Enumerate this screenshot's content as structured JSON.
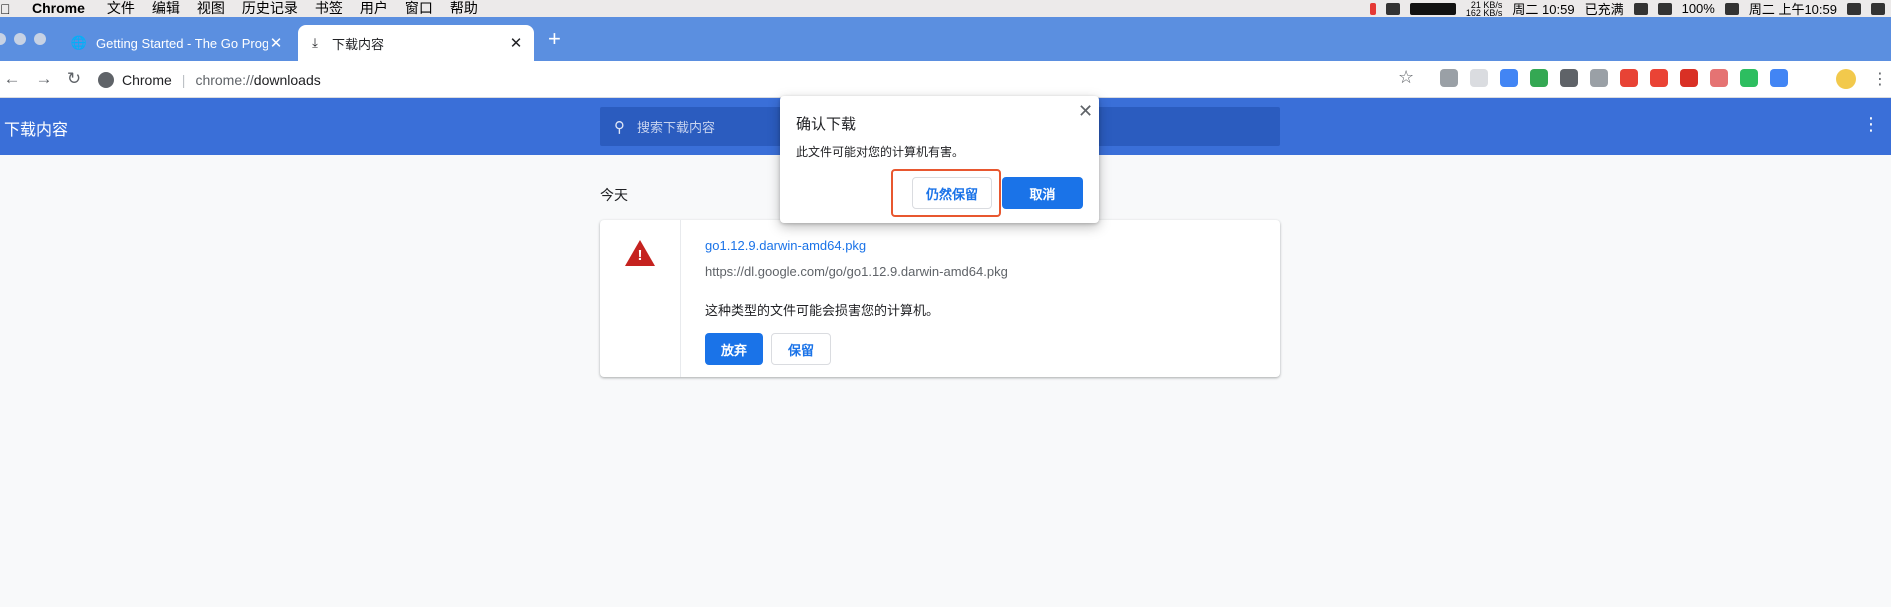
{
  "menubar": {
    "app": "Chrome",
    "items": [
      "文件",
      "编辑",
      "视图",
      "历史记录",
      "书签",
      "用户",
      "窗口",
      "帮助"
    ],
    "net_up": "21 KB/s",
    "net_down": "162 KB/s",
    "clock_short": "周二 10:59",
    "battery_status": "已充满",
    "battery_percent": "100%",
    "clock_full": "周二 上午10:59"
  },
  "tabs": [
    {
      "title": "Getting Started - The Go Progr",
      "icon": "globe-icon"
    },
    {
      "title": "下载内容",
      "icon": "download-icon"
    }
  ],
  "toolbar": {
    "site_label": "Chrome",
    "url_scheme": "chrome://",
    "url_host": "downloads"
  },
  "header": {
    "title": "下载内容",
    "search_placeholder": "搜索下载内容"
  },
  "section_label": "今天",
  "download": {
    "filename": "go1.12.9.darwin-amd64.pkg",
    "url": "https://dl.google.com/go/go1.12.9.darwin-amd64.pkg",
    "warning": "这种类型的文件可能会损害您的计算机。",
    "discard_label": "放弃",
    "keep_label": "保留"
  },
  "dialog": {
    "title": "确认下载",
    "message": "此文件可能对您的计算机有害。",
    "keep_anyway_label": "仍然保留",
    "cancel_label": "取消"
  },
  "colors": {
    "header_blue": "#3a6fd8",
    "tabstrip_blue": "#5b8fe0",
    "primary_button": "#1a73e8",
    "warning_red": "#c5221f",
    "highlight_box": "#e8572f"
  }
}
